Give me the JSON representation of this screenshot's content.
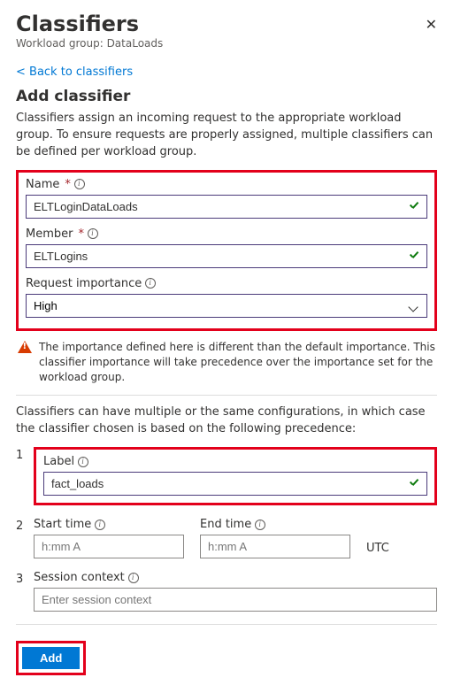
{
  "header": {
    "title": "Classifiers",
    "subtitle_prefix": "Workload group: ",
    "workload_group": "DataLoads"
  },
  "backlink": "< Back to classifiers",
  "section": {
    "title": "Add classifier",
    "description": "Classifiers assign an incoming request to the appropriate workload group. To ensure requests are properly assigned, multiple classifiers can be defined per workload group."
  },
  "fields": {
    "name": {
      "label": "Name",
      "value": "ELTLoginDataLoads"
    },
    "member": {
      "label": "Member",
      "value": "ELTLogins"
    },
    "importance": {
      "label": "Request importance",
      "value": "High"
    }
  },
  "warning": "The importance defined here is different than the default importance. This classifier importance will take precedence over the importance set for the workload group.",
  "precedence_intro": "Classifiers can have multiple or the same configurations, in which case the classifier chosen is based on the following precedence:",
  "cfg": {
    "label": {
      "num": "1",
      "label_text": "Label",
      "value": "fact_loads"
    },
    "time": {
      "num": "2",
      "start_label": "Start time",
      "end_label": "End time",
      "placeholder": "h:mm A",
      "tz": "UTC"
    },
    "session": {
      "num": "3",
      "label_text": "Session context",
      "placeholder": "Enter session context"
    }
  },
  "buttons": {
    "add": "Add"
  },
  "required_mark": "*"
}
